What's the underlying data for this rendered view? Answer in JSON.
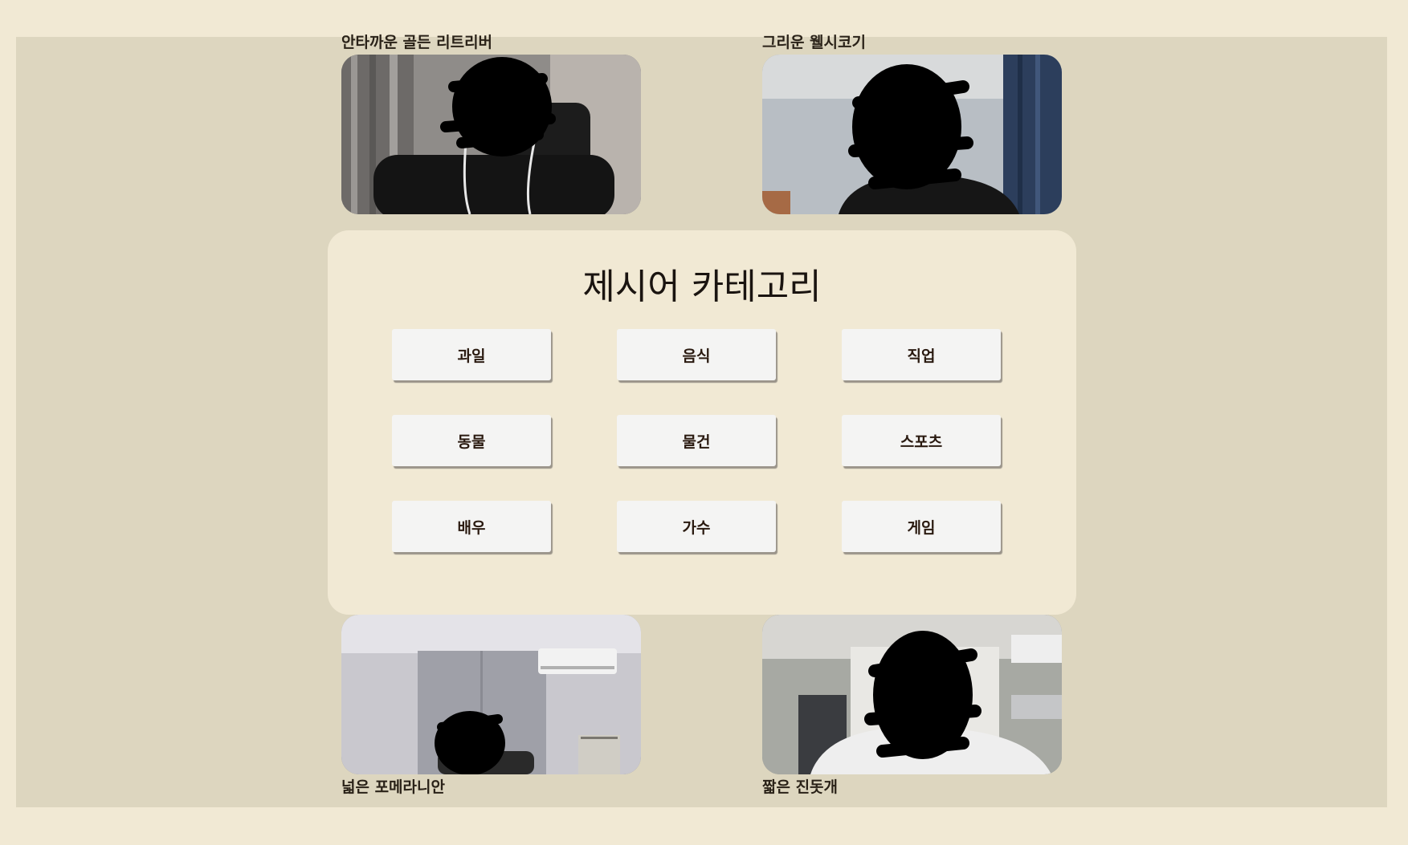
{
  "participants": [
    {
      "name": "안타까운 골든 리트리버"
    },
    {
      "name": "그리운 웰시코기"
    },
    {
      "name": "넓은 포메라니안"
    },
    {
      "name": "짧은 진돗개"
    }
  ],
  "category_panel": {
    "title": "제시어 카테고리",
    "categories": [
      "과일",
      "음식",
      "직업",
      "동물",
      "물건",
      "스포츠",
      "배우",
      "가수",
      "게임"
    ]
  },
  "colors": {
    "page_background": "#f1e9d4",
    "stage_background": "#ddd6bf",
    "panel_background": "#f1e9d4",
    "button_background": "#f4f4f3",
    "button_text": "#2a1a10"
  }
}
